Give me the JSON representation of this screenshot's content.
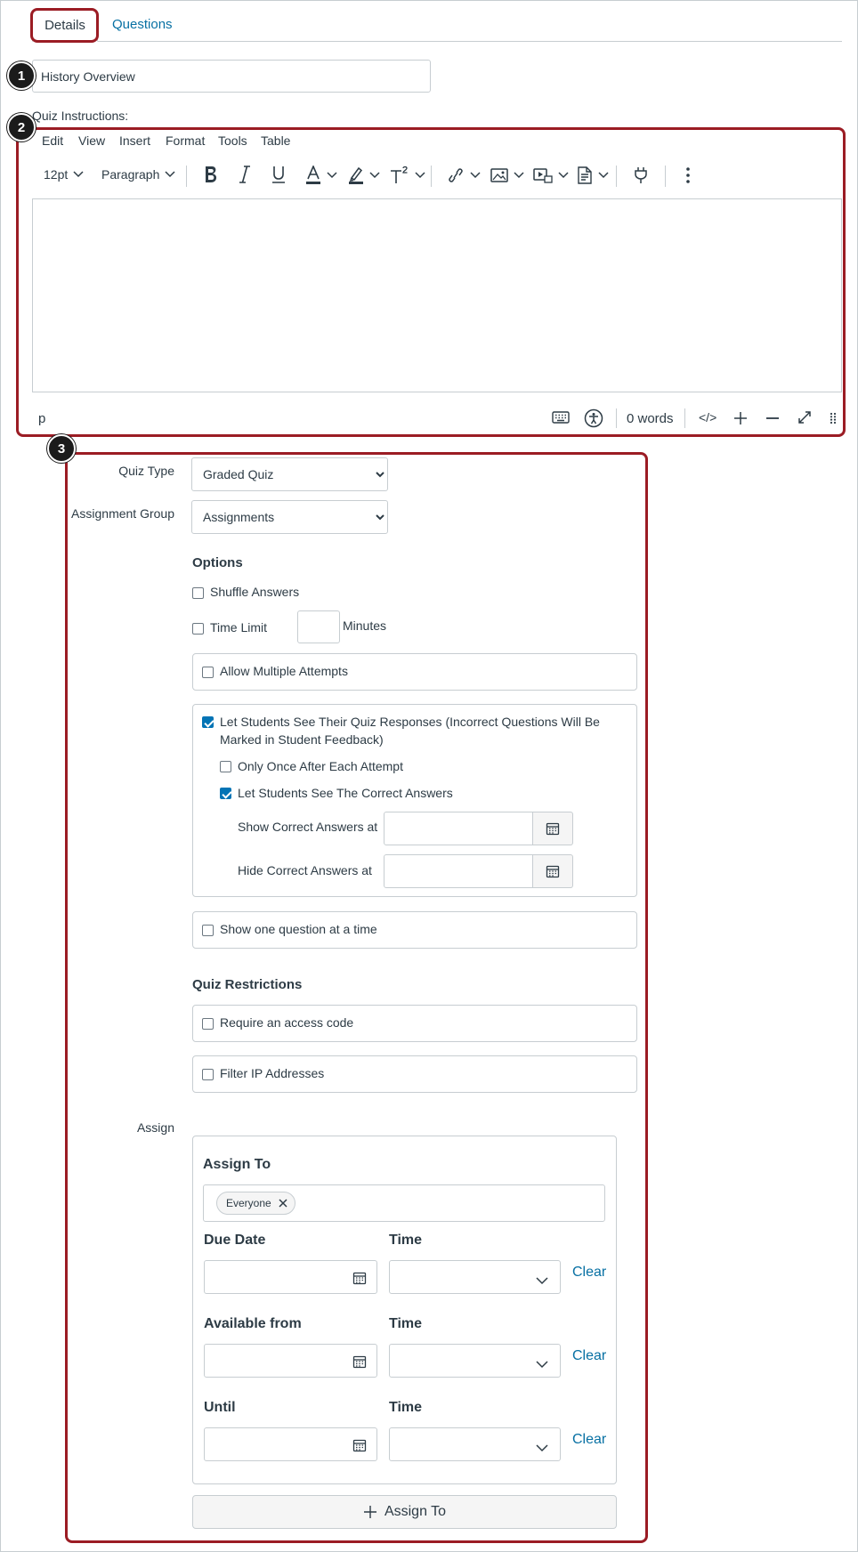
{
  "tabs": {
    "details": "Details",
    "questions": "Questions"
  },
  "badges": [
    "1",
    "2",
    "3"
  ],
  "quiz_title": {
    "value": "History Overview"
  },
  "instructions": {
    "label": "Quiz Instructions:",
    "menu": [
      "Edit",
      "View",
      "Insert",
      "Format",
      "Tools",
      "Table"
    ],
    "font_size": "12pt",
    "block_format": "Paragraph",
    "status_path": "p",
    "word_count": "0 words",
    "html_toggle": "</>"
  },
  "settings": {
    "quiz_type": {
      "label": "Quiz Type",
      "value": "Graded Quiz"
    },
    "assignment_group": {
      "label": "Assignment Group",
      "value": "Assignments"
    },
    "options": {
      "heading": "Options",
      "shuffle_answers": "Shuffle Answers",
      "time_limit": "Time Limit",
      "minutes": "Minutes",
      "allow_multiple_attempts": "Allow Multiple Attempts",
      "see_responses_line1": "Let Students See Their Quiz Responses (Incorrect Questions Will Be",
      "see_responses_line2": "Marked in Student Feedback)",
      "only_once": "Only Once After Each Attempt",
      "see_correct": "Let Students See The Correct Answers",
      "show_correct_at": "Show Correct Answers at",
      "hide_correct_at": "Hide Correct Answers at",
      "one_question": "Show one question at a time"
    },
    "restrictions": {
      "heading": "Quiz Restrictions",
      "access_code": "Require an access code",
      "filter_ip": "Filter IP Addresses"
    },
    "assign": {
      "label": "Assign",
      "assign_to_heading": "Assign To",
      "chip": "Everyone",
      "due_date": "Due Date",
      "available_from": "Available from",
      "until": "Until",
      "time": "Time",
      "clear": "Clear",
      "add_button": "Assign To"
    }
  },
  "colors": {
    "highlight": "#9b1c24",
    "link": "#0770a3",
    "checkbox_checked": "#0374b5"
  }
}
